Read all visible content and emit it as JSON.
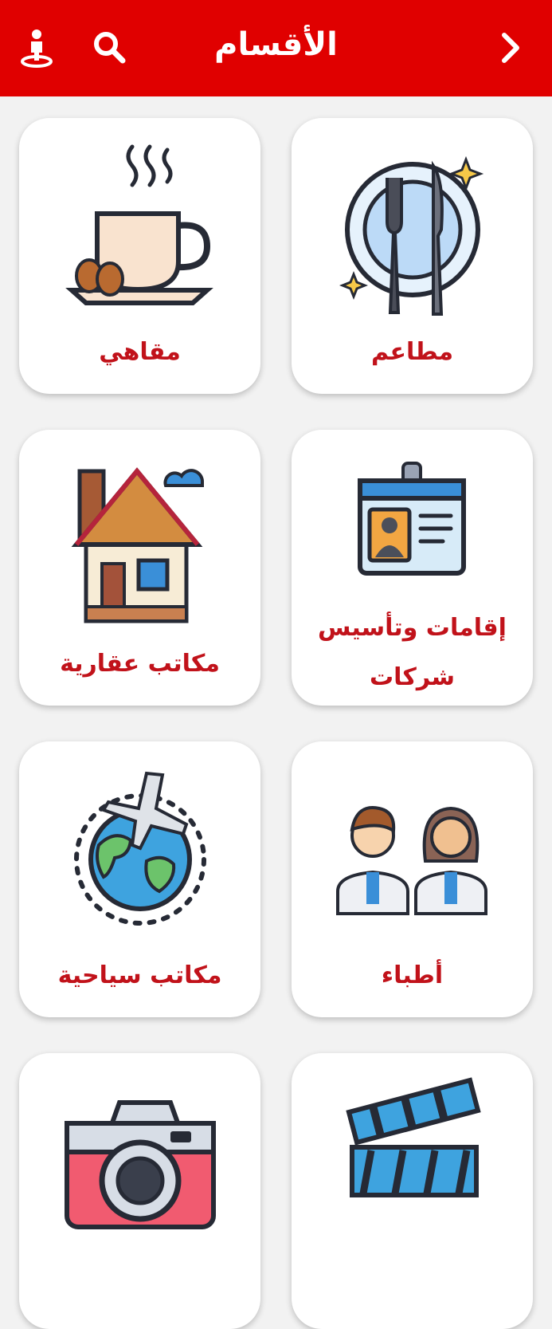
{
  "header": {
    "title": "الأقسام",
    "back_icon": "chevron-right-icon",
    "search_icon": "search-icon",
    "profile_icon": "person-location-icon",
    "bg_color": "#e00000"
  },
  "categories": [
    {
      "label": "مطاعم",
      "icon": "restaurant-icon"
    },
    {
      "label": "مقاهي",
      "icon": "coffee-cup-icon"
    },
    {
      "label": "إقامات وتأسيس شركات",
      "icon": "id-card-icon"
    },
    {
      "label": "مكاتب عقارية",
      "icon": "house-icon"
    },
    {
      "label": "أطباء",
      "icon": "doctors-icon"
    },
    {
      "label": "مكاتب سياحية",
      "icon": "travel-globe-icon"
    },
    {
      "label": "",
      "icon": "clapperboard-icon"
    },
    {
      "label": "",
      "icon": "camera-icon"
    }
  ],
  "colors": {
    "label": "#c1121a",
    "accent": "#e00000",
    "background": "#f2f2f2"
  }
}
